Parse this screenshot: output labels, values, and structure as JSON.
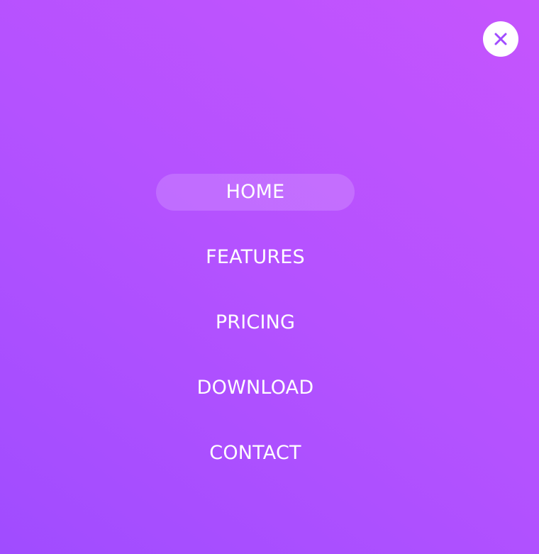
{
  "close_button": {
    "icon": "close-icon",
    "color": "#a04cff"
  },
  "menu": {
    "items": [
      {
        "label": "HOME",
        "active": true
      },
      {
        "label": "FEATURES",
        "active": false
      },
      {
        "label": "PRICING",
        "active": false
      },
      {
        "label": "DOWNLOAD",
        "active": false
      },
      {
        "label": "CONTACT",
        "active": false
      }
    ]
  },
  "colors": {
    "gradient_start": "#a04cff",
    "gradient_end": "#c554fd",
    "text": "#ffffff"
  }
}
